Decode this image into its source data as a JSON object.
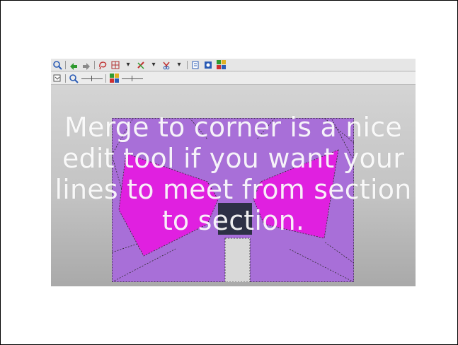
{
  "caption": "Merge to corner is a nice\nedit tool if you want your\nlines to meet from section\nto section.",
  "toolbar": {
    "row1_icons": [
      "zoom-out-icon",
      "arrow-left-icon",
      "arrow-right-icon",
      "lasso-icon",
      "grid-icon",
      "color-dropdown-icon",
      "cut-dropdown-icon",
      "page-icon",
      "info-icon",
      "palette-icon"
    ],
    "row2_icons": [
      "checkbox-icon",
      "zoom-icon",
      "zoom-slider",
      "palette-icon",
      "palette-slider"
    ]
  },
  "colors": {
    "bow": "#e020e0",
    "background_block": "#a86fd8",
    "center_knot": "#2d3045",
    "stem": "#d8d8d8",
    "caption": "#ffffff"
  }
}
